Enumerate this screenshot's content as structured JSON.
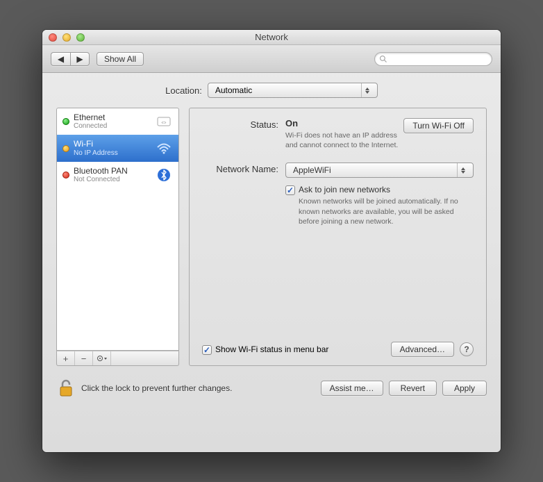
{
  "window": {
    "title": "Network"
  },
  "toolbar": {
    "back": "◀",
    "forward": "▶",
    "show_all": "Show All",
    "search_placeholder": ""
  },
  "location": {
    "label": "Location:",
    "value": "Automatic"
  },
  "services": [
    {
      "name": "Ethernet",
      "status": "Connected",
      "dot": "green",
      "icon": "ethernet"
    },
    {
      "name": "Wi-Fi",
      "status": "No IP Address",
      "dot": "orange",
      "icon": "wifi",
      "selected": true
    },
    {
      "name": "Bluetooth PAN",
      "status": "Not Connected",
      "dot": "red",
      "icon": "bluetooth"
    }
  ],
  "sidebar_buttons": {
    "add": "+",
    "remove": "−",
    "gear": "✻▾"
  },
  "detail": {
    "status_label": "Status:",
    "status_value": "On",
    "status_note": "Wi-Fi does not have an IP address and cannot connect to the Internet.",
    "toggle_button": "Turn Wi-Fi Off",
    "network_label": "Network Name:",
    "network_value": "AppleWiFi",
    "ask_join_label": "Ask to join new networks",
    "ask_join_note": "Known networks will be joined automatically. If no known networks are available, you will be asked before joining a new network.",
    "show_status_label": "Show Wi-Fi status in menu bar",
    "advanced": "Advanced…"
  },
  "footer": {
    "lock_text": "Click the lock to prevent further changes.",
    "assist": "Assist me…",
    "revert": "Revert",
    "apply": "Apply"
  }
}
